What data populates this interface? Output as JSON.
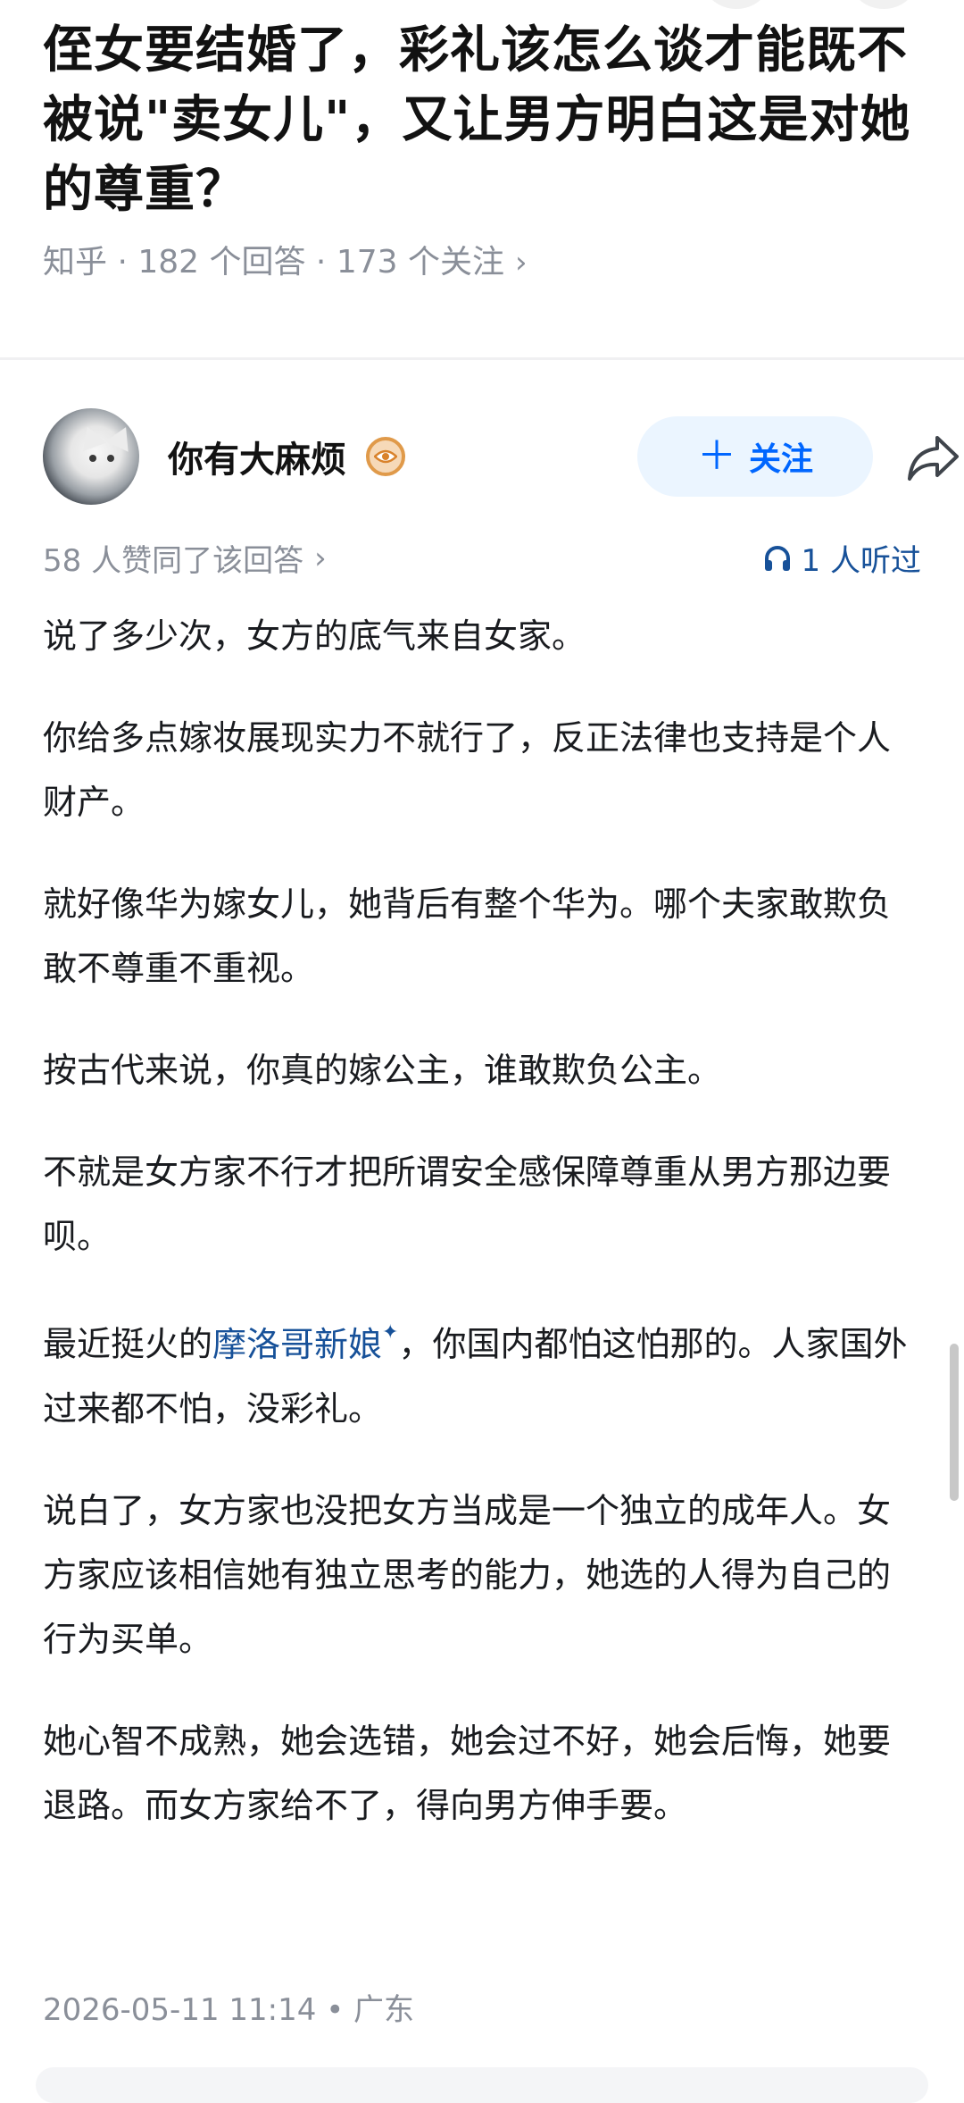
{
  "question": {
    "title": "侄女要结婚了，彩礼该怎么谈才能既不被说\"卖女儿\"，又让男方明白这是对她的尊重？",
    "meta": "知乎 · 182 个回答 · 173 个关注",
    "meta_chevron": "›"
  },
  "author": {
    "name": "你有大麻烦",
    "avatar_icon": "cat-avatar",
    "badge_icon": "eye-badge-icon",
    "follow_label": "关注",
    "follow_plus": "＋",
    "share_icon": "share-icon"
  },
  "stats": {
    "likes": "58 人赞同了该回答",
    "likes_chevron": "›",
    "listens": "1 人听过",
    "listen_icon": "headphones-icon"
  },
  "answer": {
    "p1": "说了多少次，女方的底气来自女家。",
    "p2": "你给多点嫁妆展现实力不就行了，反正法律也支持是个人财产。",
    "p3": "就好像华为嫁女儿，她背后有整个华为。哪个夫家敢欺负敢不尊重不重视。",
    "p4": "按古代来说，你真的嫁公主，谁敢欺负公主。",
    "p5": "不就是女方家不行才把所谓安全感保障尊重从男方那边要呗。",
    "p6_before": "最近挺火的",
    "p6_link": "摩洛哥新娘",
    "p6_link_mark": "✦",
    "p6_after": "，你国内都怕这怕那的。人家国外过来都不怕，没彩礼。",
    "p7": "说白了，女方家也没把女方当成是一个独立的成年人。女方家应该相信她有独立思考的能力，她选的人得为自己的行为买单。",
    "p8": "她心智不成熟，她会选错，她会过不好，她会后悔，她要退路。而女方家给不了，得向男方伸手要。"
  },
  "footer": {
    "time_location": "2026-05-11 11:14 • 广东"
  },
  "colors": {
    "accent": "#0066ff",
    "link": "#175199",
    "muted": "#8a8f99",
    "follow_bg": "#ebf5ff"
  }
}
